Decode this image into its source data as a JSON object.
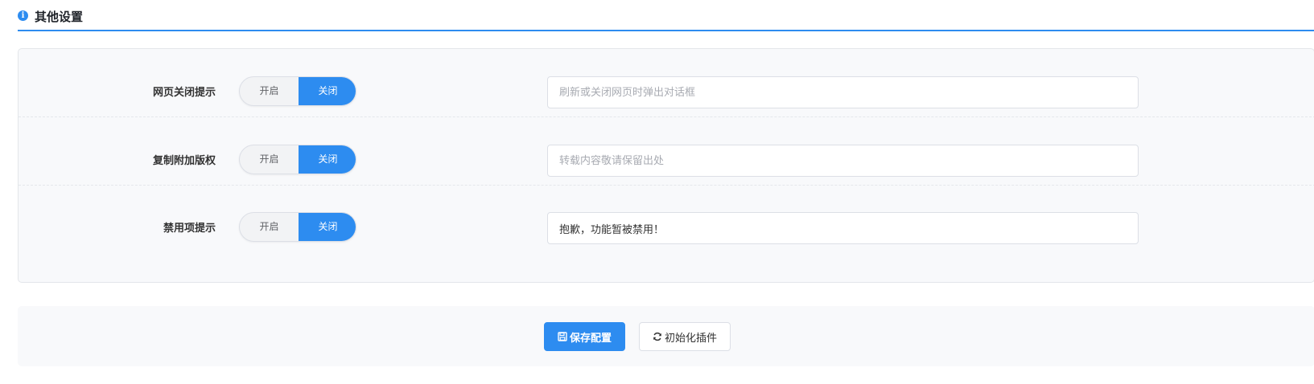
{
  "section": {
    "title": "其他设置",
    "icon": "info-circle-icon",
    "accent_color": "#2d8cf0"
  },
  "settings": [
    {
      "label": "网页关闭提示",
      "toggle": {
        "on_label": "开启",
        "off_label": "关闭",
        "selected": "关闭"
      },
      "input": {
        "value": "",
        "placeholder": "刷新或关闭网页时弹出对话框"
      }
    },
    {
      "label": "复制附加版权",
      "toggle": {
        "on_label": "开启",
        "off_label": "关闭",
        "selected": "关闭"
      },
      "input": {
        "value": "",
        "placeholder": "转载内容敬请保留出处"
      }
    },
    {
      "label": "禁用项提示",
      "toggle": {
        "on_label": "开启",
        "off_label": "关闭",
        "selected": "关闭"
      },
      "input": {
        "value": "抱歉，功能暂被禁用！",
        "placeholder": ""
      }
    }
  ],
  "footer": {
    "save_button": {
      "label": "保存配置",
      "icon": "floppy-disk-icon"
    },
    "init_button": {
      "label": "初始化插件",
      "icon": "refresh-icon"
    }
  }
}
